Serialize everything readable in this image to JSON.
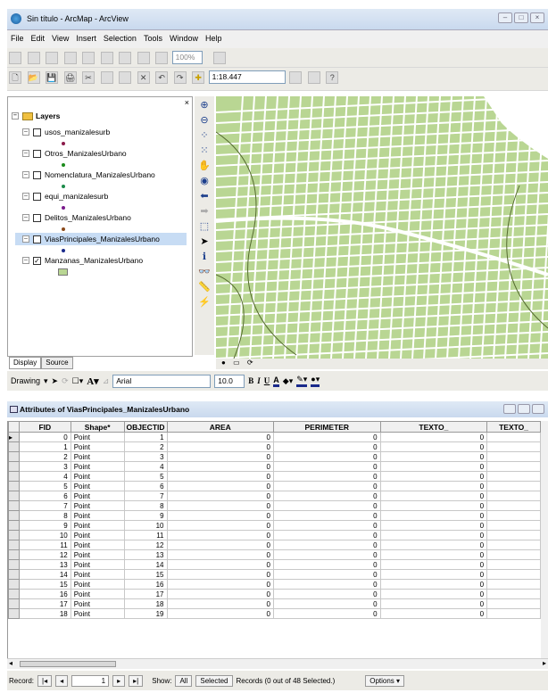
{
  "window": {
    "title": "Sin título - ArcMap - ArcView"
  },
  "menu": [
    "File",
    "Edit",
    "View",
    "Insert",
    "Selection",
    "Tools",
    "Window",
    "Help"
  ],
  "standard_toolbar": {
    "scale": "1:18.447",
    "zoom": "100%"
  },
  "toc": {
    "root": "Layers",
    "layers": [
      {
        "name": "usos_manizalesurb",
        "checked": false,
        "symbol_color": "#8b1a4a"
      },
      {
        "name": "Otros_ManizalesUrbano",
        "checked": false,
        "symbol_color": "#1c8b1c"
      },
      {
        "name": "Nomenclatura_ManizalesUrbano",
        "checked": false,
        "symbol_color": "#1c8b4a"
      },
      {
        "name": "equi_manizalesurb",
        "checked": false,
        "symbol_color": "#7a1a8b"
      },
      {
        "name": "Delitos_ManizalesUrbano",
        "checked": false,
        "symbol_color": "#8b4a1a"
      },
      {
        "name": "ViasPrincipales_ManizalesUrbano",
        "checked": false,
        "symbol_color": "#1a2a8b",
        "selected": true
      },
      {
        "name": "Manzanas_ManizalesUrbano",
        "checked": true,
        "symbol_color": "#b9d693"
      }
    ],
    "tabs": [
      "Display",
      "Source"
    ]
  },
  "drawing_toolbar": {
    "drawing_label": "Drawing",
    "font": "Arial",
    "font_size": "10.0",
    "bold": "B",
    "italic": "I",
    "underline": "U"
  },
  "attributes": {
    "title": "Attributes of ViasPrincipales_ManizalesUrbano",
    "columns": [
      "FID",
      "Shape*",
      "OBJECTID",
      "AREA",
      "PERIMETER",
      "TEXTO_",
      "TEXTO_"
    ],
    "rows": [
      [
        "0",
        "Point",
        "1",
        "0",
        "0",
        "0",
        ""
      ],
      [
        "1",
        "Point",
        "2",
        "0",
        "0",
        "0",
        ""
      ],
      [
        "2",
        "Point",
        "3",
        "0",
        "0",
        "0",
        ""
      ],
      [
        "3",
        "Point",
        "4",
        "0",
        "0",
        "0",
        ""
      ],
      [
        "4",
        "Point",
        "5",
        "0",
        "0",
        "0",
        ""
      ],
      [
        "5",
        "Point",
        "6",
        "0",
        "0",
        "0",
        ""
      ],
      [
        "6",
        "Point",
        "7",
        "0",
        "0",
        "0",
        ""
      ],
      [
        "7",
        "Point",
        "8",
        "0",
        "0",
        "0",
        ""
      ],
      [
        "8",
        "Point",
        "9",
        "0",
        "0",
        "0",
        ""
      ],
      [
        "9",
        "Point",
        "10",
        "0",
        "0",
        "0",
        ""
      ],
      [
        "10",
        "Point",
        "11",
        "0",
        "0",
        "0",
        ""
      ],
      [
        "11",
        "Point",
        "12",
        "0",
        "0",
        "0",
        ""
      ],
      [
        "12",
        "Point",
        "13",
        "0",
        "0",
        "0",
        ""
      ],
      [
        "13",
        "Point",
        "14",
        "0",
        "0",
        "0",
        ""
      ],
      [
        "14",
        "Point",
        "15",
        "0",
        "0",
        "0",
        ""
      ],
      [
        "15",
        "Point",
        "16",
        "0",
        "0",
        "0",
        ""
      ],
      [
        "16",
        "Point",
        "17",
        "0",
        "0",
        "0",
        ""
      ],
      [
        "17",
        "Point",
        "18",
        "0",
        "0",
        "0",
        ""
      ],
      [
        "18",
        "Point",
        "19",
        "0",
        "0",
        "0",
        ""
      ]
    ]
  },
  "footer": {
    "record_label": "Record:",
    "record_value": "1",
    "show_label": "Show:",
    "all": "All",
    "selected": "Selected",
    "records_text": "Records (0 out of 48 Selected.)",
    "options": "Options"
  }
}
